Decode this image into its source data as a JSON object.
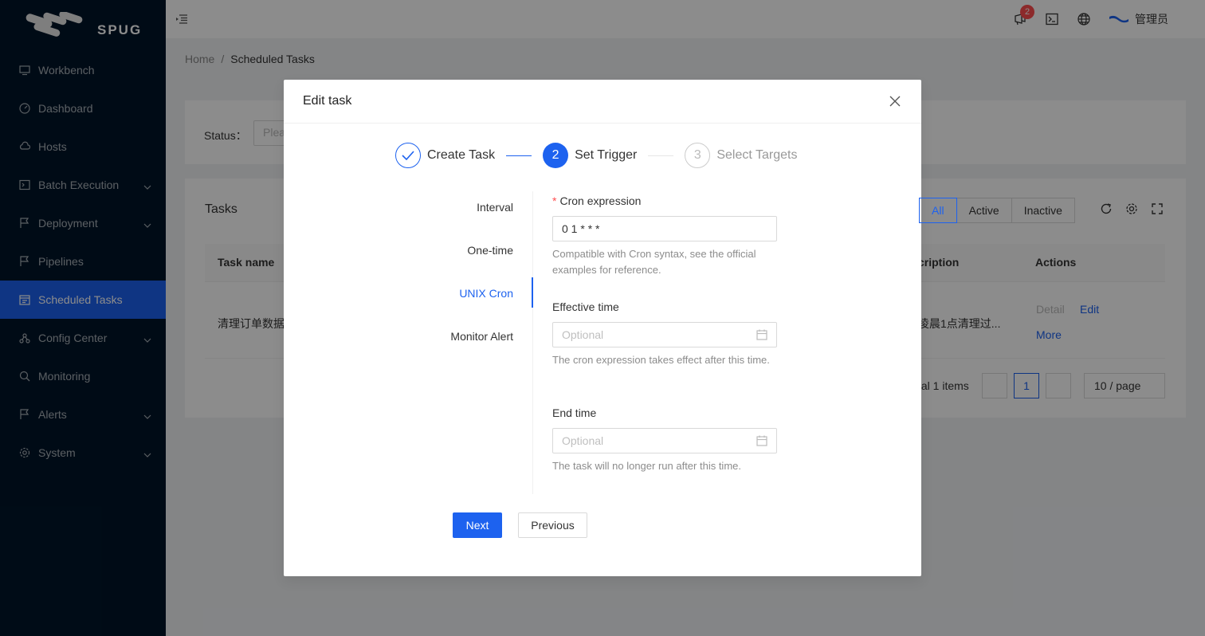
{
  "brand": {
    "name": "SPUG"
  },
  "sidebar": {
    "items": [
      {
        "label": "Workbench",
        "icon": "desktop-icon",
        "arrow": false
      },
      {
        "label": "Dashboard",
        "icon": "dashboard-icon",
        "arrow": false
      },
      {
        "label": "Hosts",
        "icon": "cloud-server-icon",
        "arrow": false
      },
      {
        "label": "Batch Execution",
        "icon": "code-icon",
        "arrow": true
      },
      {
        "label": "Deployment",
        "icon": "flag-icon",
        "arrow": true
      },
      {
        "label": "Pipelines",
        "icon": "pipeline-icon",
        "arrow": false
      },
      {
        "label": "Scheduled Tasks",
        "icon": "schedule-icon",
        "arrow": false,
        "active": true
      },
      {
        "label": "Config Center",
        "icon": "deployment-unit-icon",
        "arrow": true
      },
      {
        "label": "Monitoring",
        "icon": "monitor-icon",
        "arrow": false
      },
      {
        "label": "Alerts",
        "icon": "alert-icon",
        "arrow": true
      },
      {
        "label": "System",
        "icon": "setting-icon",
        "arrow": true
      }
    ]
  },
  "header": {
    "notification_count": "2",
    "user_name": "管理员"
  },
  "breadcrumb": {
    "home": "Home",
    "separator": "/",
    "current": "Scheduled Tasks"
  },
  "filter": {
    "status_label": "Status：",
    "status_placeholder": "Plea"
  },
  "table": {
    "title": "Tasks",
    "segments": [
      "All",
      "Active",
      "Inactive"
    ],
    "columns": {
      "name": "Task name",
      "description": "cription",
      "actions": "Actions"
    },
    "row": {
      "name": "清理订单数据",
      "description": "凌晨1点清理过...",
      "action_detail": "Detail",
      "action_edit": "Edit",
      "action_more": "More"
    },
    "total": "tal 1 items",
    "page": "1",
    "page_size": "10 / page"
  },
  "modal": {
    "title": "Edit task",
    "steps": [
      {
        "number": "1",
        "title": "Create Task",
        "status": "done"
      },
      {
        "number": "2",
        "title": "Set Trigger",
        "status": "current"
      },
      {
        "number": "3",
        "title": "Select Targets",
        "status": "wait"
      }
    ],
    "trigger_tabs": [
      {
        "label": "Interval"
      },
      {
        "label": "One-time"
      },
      {
        "label": "UNIX Cron",
        "active": true
      },
      {
        "label": "Monitor Alert"
      }
    ],
    "form": {
      "cron_label": "Cron expression",
      "cron_value": "0 1 * * *",
      "cron_help": "Compatible with Cron syntax, see the official examples for reference.",
      "effective_label": "Effective time",
      "effective_placeholder": "Optional",
      "effective_help": "The cron expression takes effect after this time.",
      "end_label": "End time",
      "end_placeholder": "Optional",
      "end_help": "The task will no longer run after this time."
    },
    "buttons": {
      "next": "Next",
      "previous": "Previous"
    }
  },
  "colors": {
    "primary": "#1d62ef",
    "sidebar_bg": "#001529",
    "danger": "#ff4d4f"
  }
}
